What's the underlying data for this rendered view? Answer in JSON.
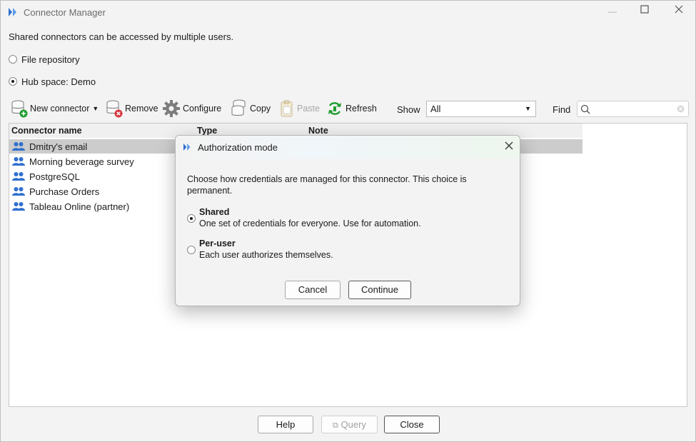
{
  "window": {
    "title": "Connector Manager",
    "subtitle": "Shared connectors can be accessed by multiple users."
  },
  "location": {
    "options": [
      {
        "label": "File repository",
        "checked": false
      },
      {
        "label": "Hub space: Demo",
        "checked": true
      }
    ]
  },
  "toolbar": {
    "new_connector": "New connector",
    "remove": "Remove",
    "configure": "Configure",
    "copy": "Copy",
    "paste": "Paste",
    "refresh": "Refresh",
    "show_label": "Show",
    "show_value": "All",
    "find_label": "Find",
    "find_value": ""
  },
  "table": {
    "columns": [
      "Connector name",
      "Type",
      "Note"
    ],
    "rows": [
      {
        "name": "Dmitry's email",
        "selected": true
      },
      {
        "name": "Morning beverage survey",
        "selected": false
      },
      {
        "name": "PostgreSQL",
        "selected": false
      },
      {
        "name": "Purchase Orders",
        "selected": false
      },
      {
        "name": "Tableau Online (partner)",
        "selected": false
      }
    ]
  },
  "footer": {
    "help": "Help",
    "query": "Query",
    "close": "Close"
  },
  "dialog": {
    "title": "Authorization mode",
    "text": "Choose how credentials are managed for this connector. This choice is permanent.",
    "options": [
      {
        "title": "Shared",
        "desc": "One set of credentials for everyone. Use for automation.",
        "checked": true
      },
      {
        "title": "Per-user",
        "desc": "Each user authorizes themselves.",
        "checked": false
      }
    ],
    "cancel": "Cancel",
    "continue": "Continue"
  },
  "colors": {
    "accent": "#2f6fcf",
    "selection": "#cccccc",
    "add_green": "#1f9d2f",
    "remove_red": "#d9363e"
  }
}
